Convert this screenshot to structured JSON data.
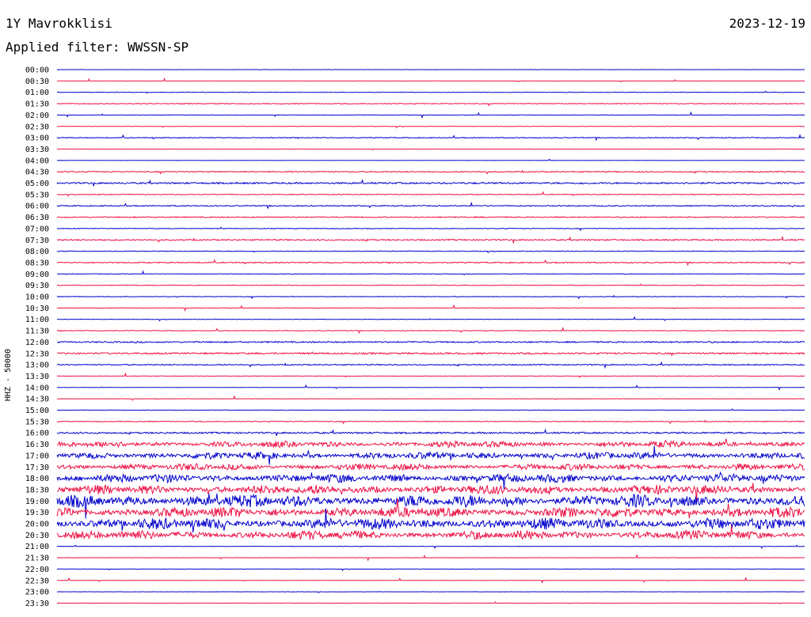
{
  "header": {
    "station": "1Y Mavrokklisi",
    "date": "2023-12-19",
    "filter_label": "Applied filter: WWSSN-SP"
  },
  "chart_data": {
    "type": "line",
    "title": "1Y Mavrokklisi",
    "ylabel": "HHZ - 50000",
    "colors": [
      "#0000cc",
      "#ee1144"
    ],
    "rows": [
      "00:00",
      "00:30",
      "01:00",
      "01:30",
      "02:00",
      "02:30",
      "03:00",
      "03:30",
      "04:00",
      "04:30",
      "05:00",
      "05:30",
      "06:00",
      "06:30",
      "07:00",
      "07:30",
      "08:00",
      "08:30",
      "09:00",
      "09:30",
      "10:00",
      "10:30",
      "11:00",
      "11:30",
      "12:00",
      "12:30",
      "13:00",
      "13:30",
      "14:00",
      "14:30",
      "15:00",
      "15:30",
      "16:00",
      "16:30",
      "17:00",
      "17:30",
      "18:00",
      "18:30",
      "19:00",
      "19:30",
      "20:00",
      "20:30",
      "21:00",
      "21:30",
      "22:00",
      "22:30",
      "23:00",
      "23:30"
    ],
    "activity": [
      0.05,
      0.05,
      0.1,
      0.15,
      0.08,
      0.08,
      0.15,
      0.05,
      0.05,
      0.2,
      0.3,
      0.15,
      0.2,
      0.2,
      0.12,
      0.25,
      0.12,
      0.2,
      0.1,
      0.12,
      0.1,
      0.1,
      0.08,
      0.12,
      0.25,
      0.3,
      0.2,
      0.08,
      0.06,
      0.06,
      0.08,
      0.15,
      0.3,
      1.3,
      1.5,
      1.4,
      1.8,
      2.0,
      2.6,
      2.2,
      2.4,
      1.9,
      0.08,
      0.06,
      0.06,
      0.06,
      0.05,
      0.05
    ]
  }
}
